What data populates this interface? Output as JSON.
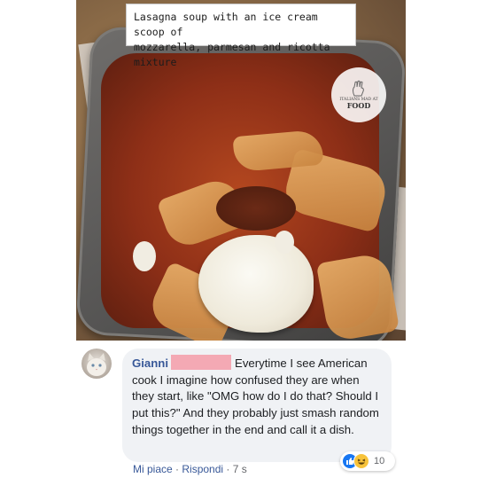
{
  "post": {
    "caption": "Lasagna soup with an ice cream scoop of\nmozzarella, parmesan and ricotta mixture",
    "watermark": {
      "small_text": "ITALIANS MAD AT",
      "big_text": "FOOD"
    }
  },
  "comment": {
    "author": "Gianni",
    "text": "Everytime I see American cook I imagine how confused they are when they start, like \"OMG how do I do that? Should I put this?\" And they probably just smash random things together in the end and call it a dish.",
    "reaction_count": "10",
    "reaction_icons": [
      "like-icon",
      "haha-icon"
    ],
    "actions": {
      "like": "Mi piace",
      "separator": "·",
      "reply": "Rispondi",
      "time": "7 s"
    }
  },
  "colors": {
    "link_blue": "#385898",
    "bubble_bg": "#f0f2f5",
    "redaction": "#f4a9b4",
    "like_blue": "#1877f2"
  }
}
